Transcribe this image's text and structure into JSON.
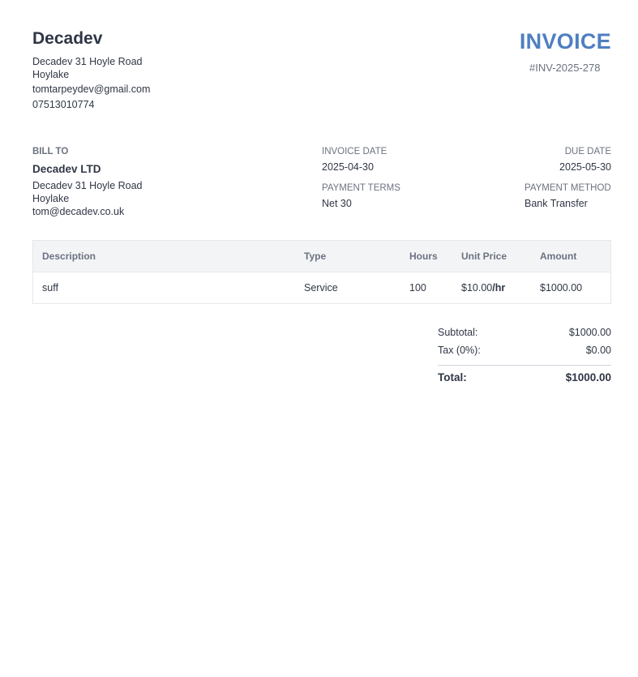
{
  "company": {
    "name": "Decadev",
    "address_line1": "Decadev 31 Hoyle Road",
    "address_line2": "Hoylake",
    "email": "tomtarpeydev@gmail.com",
    "phone": "07513010774"
  },
  "invoice": {
    "title": "INVOICE",
    "number": "#INV-2025-278"
  },
  "bill_to": {
    "label": "BILL TO",
    "name": "Decadev LTD",
    "address_line1": "Decadev 31 Hoyle Road",
    "address_line2": "Hoylake",
    "email": "tom@decadev.co.uk"
  },
  "meta": {
    "invoice_date_label": "INVOICE DATE",
    "invoice_date": "2025-04-30",
    "due_date_label": "DUE DATE",
    "due_date": "2025-05-30",
    "payment_terms_label": "PAYMENT TERMS",
    "payment_terms": "Net 30",
    "payment_method_label": "PAYMENT METHOD",
    "payment_method": "Bank Transfer"
  },
  "table": {
    "headers": [
      "Description",
      "Type",
      "Hours",
      "Unit Price",
      "Amount"
    ],
    "rows": [
      {
        "description": "suff",
        "type": "Service",
        "hours": "100",
        "unit_price": "$10.00",
        "unit_suffix": "/hr",
        "amount": "$1000.00"
      }
    ]
  },
  "totals": {
    "subtotal_label": "Subtotal:",
    "subtotal": "$1000.00",
    "tax_label": "Tax (0%):",
    "tax": "$0.00",
    "total_label": "Total:",
    "total": "$1000.00"
  },
  "colors": {
    "accent": "#4f7fc1",
    "text": "#2f3645",
    "muted": "#6b7280",
    "header_bg": "#f3f4f6"
  }
}
